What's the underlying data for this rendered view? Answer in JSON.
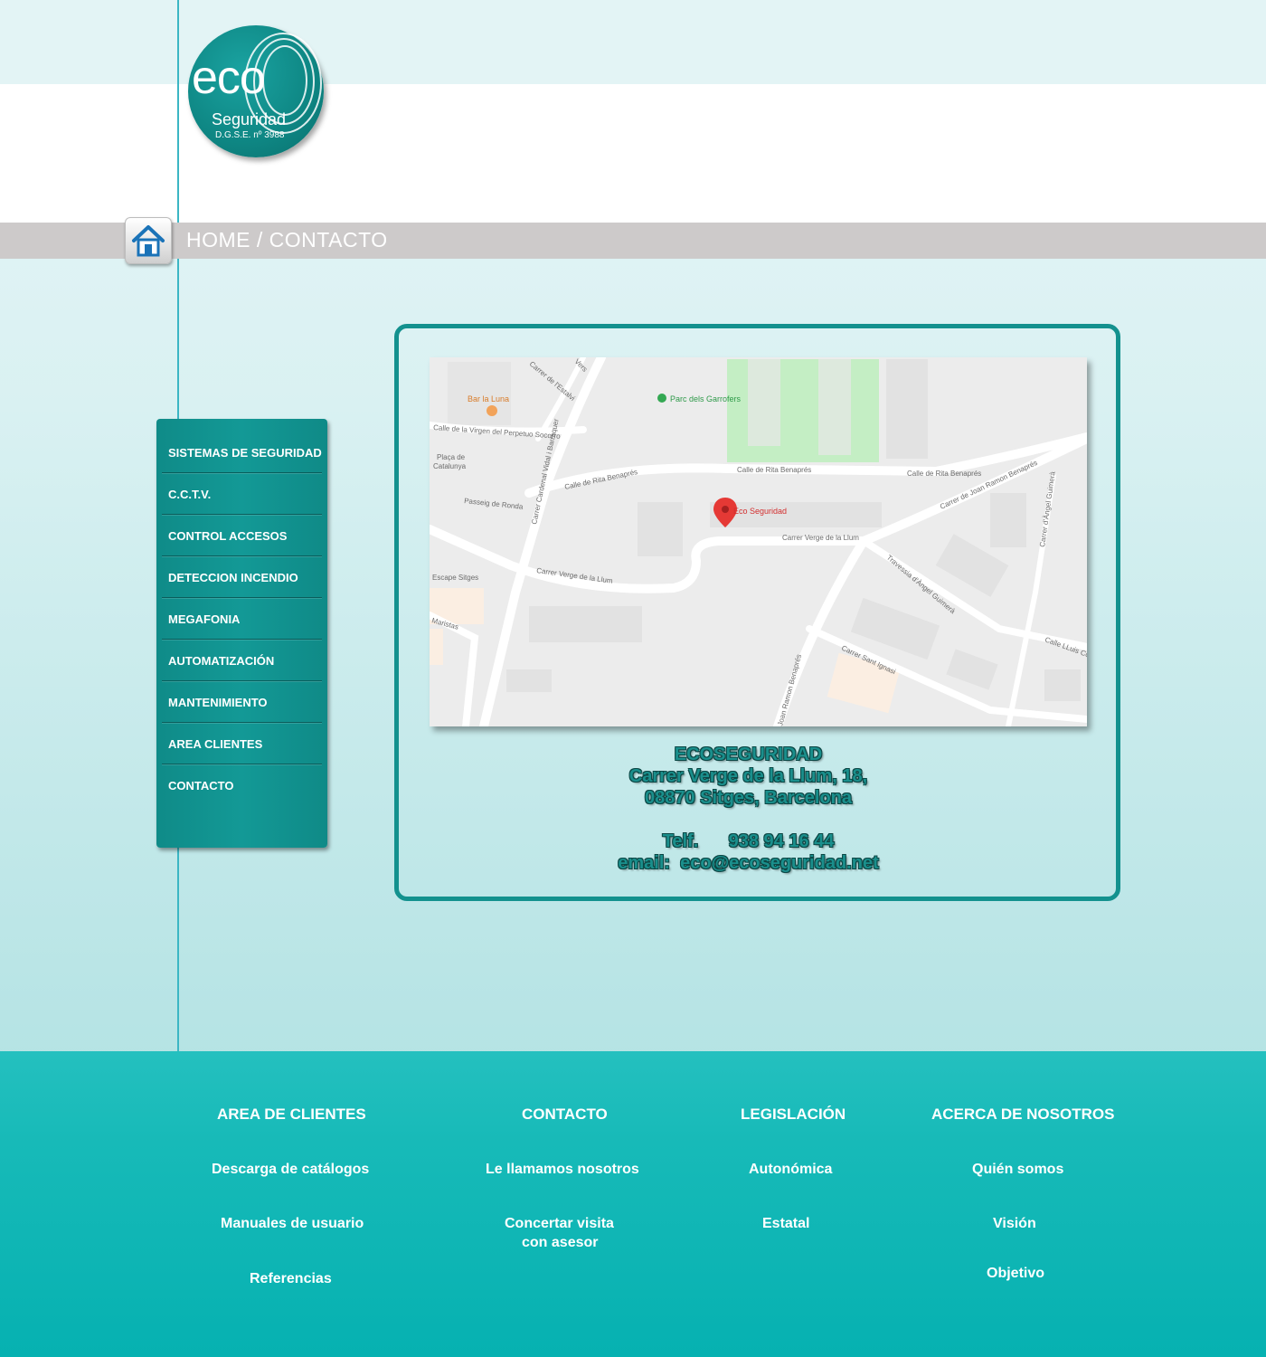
{
  "brand": {
    "logo_main": "eco",
    "logo_sub": "Seguridad",
    "logo_reg": "D.G.S.E. nº 3988",
    "accent": "#13918e"
  },
  "breadcrumb": {
    "text": "HOME / CONTACTO",
    "home_icon": "home-icon"
  },
  "sidebar": {
    "items": [
      {
        "label": "SISTEMAS DE SEGURIDAD"
      },
      {
        "label": "C.C.T.V."
      },
      {
        "label": "CONTROL ACCESOS"
      },
      {
        "label": "DETECCION INCENDIO"
      },
      {
        "label": "MEGAFONIA"
      },
      {
        "label": "AUTOMATIZACIÓN"
      },
      {
        "label": "MANTENIMIENTO"
      },
      {
        "label": "AREA CLIENTES"
      },
      {
        "label": "CONTACTO"
      }
    ]
  },
  "map": {
    "labels": {
      "bar": "Bar la Luna",
      "park": "Parc dels Garrofers",
      "street_virgen": "Calle de la Virgen del Perpetuo Socorro",
      "placa": "Plaça de",
      "placa2": "Catalunya",
      "rita1": "Calle de Rita Benaprés",
      "rita2": "Calle de Rita Benaprés",
      "rita3": "Calle de Rita Benaprés",
      "passeig": "Passeig de Ronda",
      "vidal": "Carrer Cardenal Vidal i Barraquer",
      "estalvi": "Carrer de l'Estalvi",
      "marker": "Eco Seguridad",
      "verge1": "Carrer Verge de la Llum",
      "verge2": "Carrer Verge de la Llum",
      "escape": "Escape Sitges",
      "maristas": "Maristas",
      "joan": "Carrer de Joan Ramon Benaprés",
      "guimera": "Carrer d'Àngel Guimerà",
      "travessia": "Travessia d'Àngel Guimerà",
      "lluis": "Calle LLuis Com",
      "ignasi": "Carrer Sant Ignasi",
      "ramon": "Joan Ramon Benaprés",
      "vers": "Vers"
    }
  },
  "contact": {
    "company": "ECOSEGURIDAD",
    "address1": "Carrer Verge de la Llum, 18,",
    "address2": "08870 Sitges, Barcelona",
    "phone": "Telf.      938 94 16 44",
    "email": "email:  eco@ecoseguridad.net"
  },
  "footer": {
    "columns": [
      {
        "heading": "AREA DE CLIENTES",
        "links": [
          "Descarga de catálogos",
          "Manuales de usuario",
          "Referencias"
        ]
      },
      {
        "heading": "CONTACTO",
        "links": [
          "Le llamamos nosotros",
          "Concertar visita",
          "con asesor"
        ]
      },
      {
        "heading": "LEGISLACIÓN",
        "links": [
          "Autonómica",
          "Estatal"
        ]
      },
      {
        "heading": "ACERCA DE NOSOTROS",
        "links": [
          "Quién somos",
          "Visión",
          "Objetivo"
        ]
      }
    ]
  }
}
